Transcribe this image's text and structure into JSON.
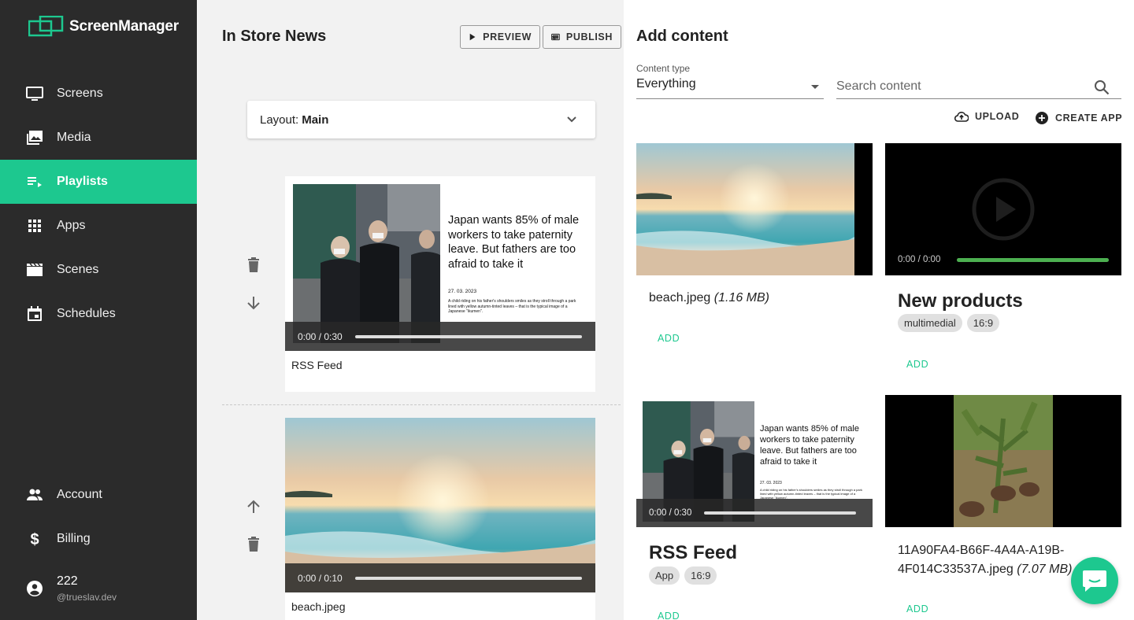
{
  "app": {
    "name": "ScreenManager"
  },
  "sidebar": {
    "items": [
      {
        "label": "Screens",
        "icon": "monitor-icon"
      },
      {
        "label": "Media",
        "icon": "media-icon"
      },
      {
        "label": "Playlists",
        "icon": "playlist-icon",
        "active": true
      },
      {
        "label": "Apps",
        "icon": "apps-grid-icon"
      },
      {
        "label": "Scenes",
        "icon": "clapperboard-icon"
      },
      {
        "label": "Schedules",
        "icon": "calendar-icon"
      }
    ],
    "bottom_items": [
      {
        "label": "Account",
        "icon": "people-icon"
      },
      {
        "label": "Billing",
        "icon": "dollar-icon"
      }
    ],
    "user": {
      "name": "222",
      "handle": "@trueslav.dev"
    }
  },
  "playlist": {
    "title": "In Store News",
    "preview_label": "PREVIEW",
    "publish_label": "PUBLISH",
    "layout_label": "Layout:",
    "layout_value": "Main",
    "items": [
      {
        "name": "RSS Feed",
        "time": "0:00 / 0:30",
        "progress": 0,
        "headline": "Japan wants 85% of male workers to take paternity leave. But fathers are too afraid to take it",
        "date": "27. 03. 2023",
        "summary": "A child riding on his father's shoulders smiles as they stroll through a park lined with yellow autumn-tinted leaves – that is the typical image of a Japanese \"ikumen\"."
      },
      {
        "name": "beach.jpeg",
        "time": "0:00 / 0:10",
        "progress": 0
      }
    ]
  },
  "add_content": {
    "title": "Add content",
    "content_type_label": "Content type",
    "content_type_value": "Everything",
    "search_placeholder": "Search content",
    "upload_label": "UPLOAD",
    "create_app_label": "CREATE APP",
    "add_label": "ADD",
    "tiles": [
      {
        "kind": "image",
        "name": "beach.jpeg",
        "size": "(1.16 MB)"
      },
      {
        "kind": "video",
        "title": "New products",
        "time": "0:00 / 0:00",
        "progress": 1,
        "chips": [
          "multimedial",
          "16:9"
        ]
      },
      {
        "kind": "app",
        "title": "RSS Feed",
        "time": "0:00 / 0:30",
        "progress": 0,
        "chips": [
          "App",
          "16:9"
        ],
        "headline": "Japan wants 85% of male workers to take paternity leave. But fathers are too afraid to take it",
        "date": "27. 03. 2023",
        "summary": "A child riding on his father's shoulders smiles as they stroll through a park lined with yellow autumn-tinted leaves – that is the typical image of a Japanese \"ikumen\"."
      },
      {
        "kind": "image",
        "name": "11A90FA4-B66F-4A4A-A19B-4F014C33537A.jpeg",
        "name_line1": "11A90FA4-B66F-4A4A-A19B-",
        "name_line2": "4F014C33537A.jpeg",
        "size": "(7.07 MB)"
      }
    ]
  },
  "colors": {
    "accent": "#1dc88f",
    "sidebar_bg": "#2b2b2b",
    "video_progress": "#4caf50"
  }
}
